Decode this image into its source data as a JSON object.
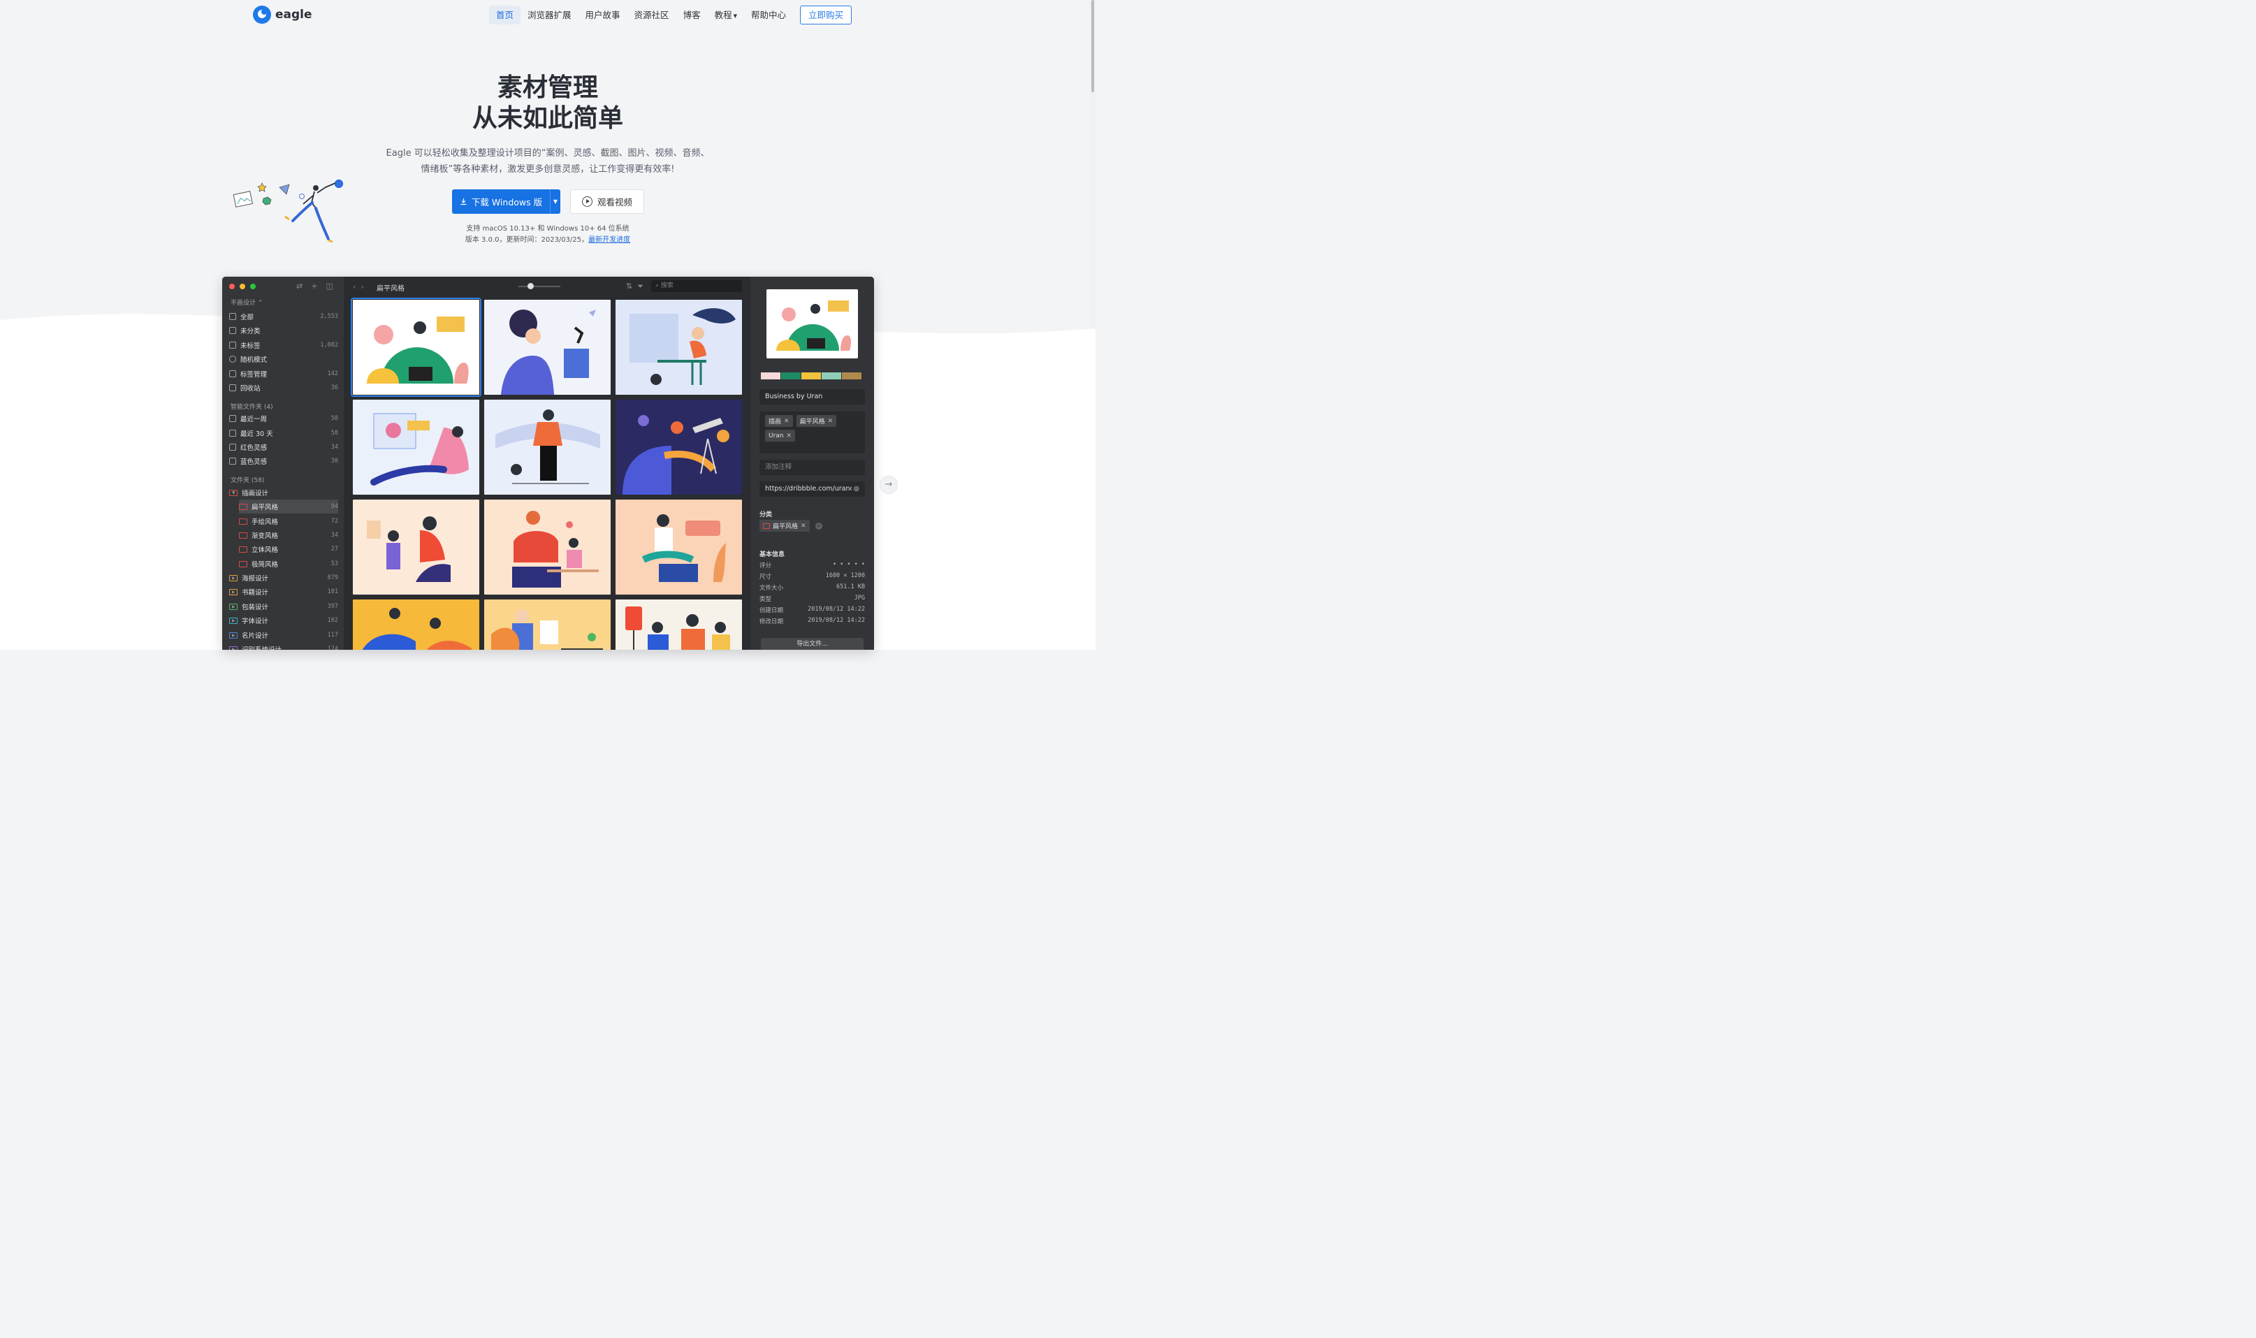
{
  "brand": {
    "name": "eagle"
  },
  "nav": {
    "items": [
      "首页",
      "浏览器扩展",
      "用户故事",
      "资源社区",
      "博客",
      "教程",
      "帮助中心"
    ],
    "buy_label": "立即购买"
  },
  "hero": {
    "title_line1": "素材管理",
    "title_line2": "从未如此简单",
    "desc_line1": "Eagle 可以轻松收集及整理设计项目的“案例、灵感、截图、图片、视频、音频、",
    "desc_line2": "情绪板”等各种素材，激发更多创意灵感，让工作变得更有效率!",
    "download_label": "下载 Windows 版",
    "watch_label": "观看视频",
    "system_note": "支持 macOS 10.13+ 和 Windows 10+ 64 位系统",
    "version_note": "版本 3.0.0，更新时间：2023/03/25，",
    "dev_progress_link": "最新开发进度"
  },
  "app": {
    "library_name": "平画设计",
    "quick": [
      {
        "label": "全部",
        "count": "2,553"
      },
      {
        "label": "未分类",
        "count": ""
      },
      {
        "label": "未标签",
        "count": "1,082"
      },
      {
        "label": "随机模式",
        "count": ""
      },
      {
        "label": "标签管理",
        "count": "142"
      },
      {
        "label": "回收站",
        "count": "36"
      }
    ],
    "smart_title": "智能文件夹 (4)",
    "smart": [
      {
        "label": "最近一周",
        "count": "58"
      },
      {
        "label": "最近 30 天",
        "count": "58"
      },
      {
        "label": "红色灵感",
        "count": "34"
      },
      {
        "label": "蓝色灵感",
        "count": "30"
      }
    ],
    "folders_title": "文件夹 (58)",
    "folders": [
      {
        "label": "插画设计",
        "count": ""
      },
      {
        "label": "扁平风格",
        "count": "94"
      },
      {
        "label": "手绘风格",
        "count": "72"
      },
      {
        "label": "渐变风格",
        "count": "34"
      },
      {
        "label": "立体风格",
        "count": "27"
      },
      {
        "label": "极简风格",
        "count": "53"
      },
      {
        "label": "海报设计",
        "count": "879"
      },
      {
        "label": "书籍设计",
        "count": "181"
      },
      {
        "label": "包装设计",
        "count": "397"
      },
      {
        "label": "字体设计",
        "count": "102"
      },
      {
        "label": "名片设计",
        "count": "117"
      },
      {
        "label": "识别系统设计",
        "count": "174"
      }
    ],
    "current_folder": "扁平风格",
    "search_placeholder": "搜索",
    "inspector": {
      "name": "Business by Uran",
      "tags": [
        "插画",
        "扁平风格",
        "Uran"
      ],
      "note_placeholder": "添加注释",
      "url": "https://dribbble.com/urancd",
      "category_label": "分类",
      "category_value": "扁平风格",
      "info_title": "基本信息",
      "rows": [
        {
          "k": "评分",
          "v": "• • • • •"
        },
        {
          "k": "尺寸",
          "v": "1600 × 1200"
        },
        {
          "k": "文件大小",
          "v": "651.1 KB"
        },
        {
          "k": "类型",
          "v": "JPG"
        },
        {
          "k": "创建日期",
          "v": "2019/08/12 14:22"
        },
        {
          "k": "修改日期",
          "v": "2019/08/12 14:22"
        }
      ],
      "export_label": "导出文件...",
      "palette": [
        "#f8d9da",
        "#1f8a66",
        "#f2c23c",
        "#8fcfb9",
        "#b08a4d"
      ]
    }
  }
}
